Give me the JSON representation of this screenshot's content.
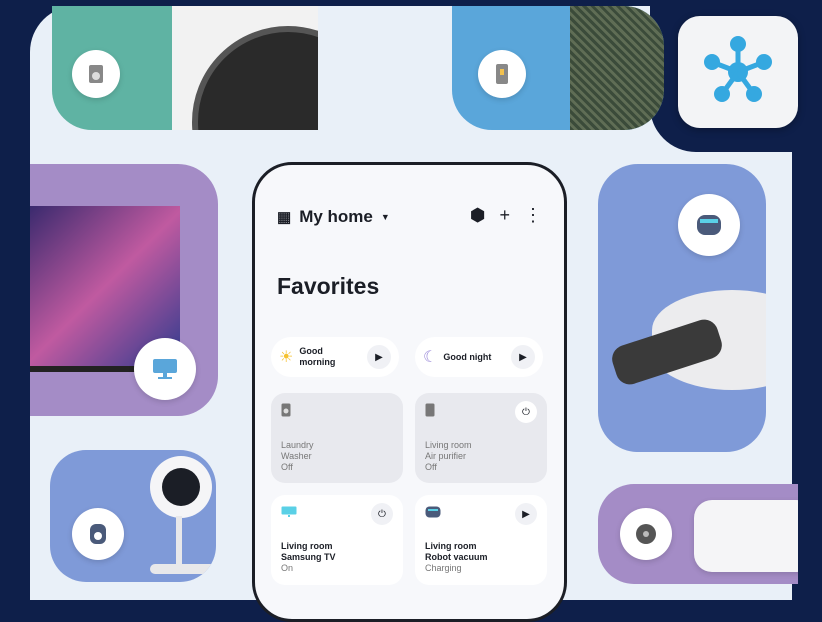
{
  "phone": {
    "home_label": "My home",
    "favorites_title": "Favorites",
    "scenes": [
      {
        "label_line1": "Good",
        "label_line2": "morning"
      },
      {
        "label_line1": "Good night",
        "label_line2": ""
      }
    ],
    "devices": [
      {
        "line1": "Laundry",
        "line2": "Washer",
        "status": "Off"
      },
      {
        "line1": "Living room",
        "line2": "Air purifier",
        "status": "Off"
      },
      {
        "line1": "Living room",
        "line2": "Samsung TV",
        "status": "On"
      },
      {
        "line1": "Living room",
        "line2": "Robot vacuum",
        "status": "Charging"
      }
    ]
  },
  "colors": {
    "background": "#0e1f4a",
    "panel": "#e9f0f8",
    "teal": "#5fb3a3",
    "sky": "#5aa6da",
    "purple": "#a48cc6",
    "periwinkle": "#7f9ad8",
    "app_icon": "#35a8e0"
  },
  "icons": [
    "washer-icon",
    "air-purifier-icon",
    "smartthings-app-icon",
    "tv-icon",
    "robot-vacuum-icon",
    "camera-icon",
    "hub-icon",
    "sun-icon",
    "moon-icon",
    "plus-icon",
    "more-icon",
    "power-icon",
    "play-icon"
  ]
}
